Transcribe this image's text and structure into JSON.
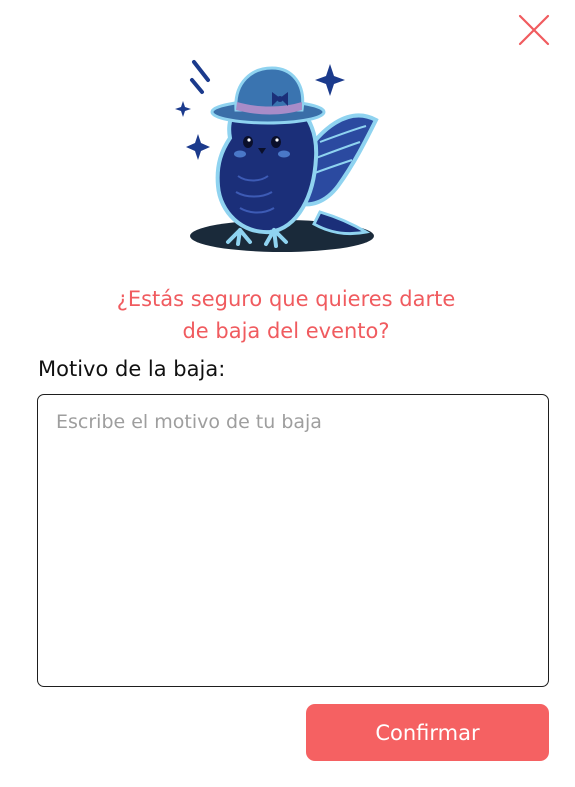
{
  "dialog": {
    "close_icon": "close-icon",
    "illustration_icon": "bird-with-hat-illustration",
    "question_line1": "¿Estás seguro que quieres darte",
    "question_line2": "de baja del evento?",
    "reason_label": "Motivo de la baja:",
    "reason_placeholder": "Escribe el motivo de tu baja",
    "reason_value": "",
    "confirm_label": "Confirmar"
  },
  "colors": {
    "accent": "#f56162",
    "question_text": "#f05b5f",
    "close_icon": "#f05b5f",
    "bird_body": "#1b2f79",
    "bird_outline": "#8fd3f0",
    "sparkles": "#1b3a8c"
  }
}
